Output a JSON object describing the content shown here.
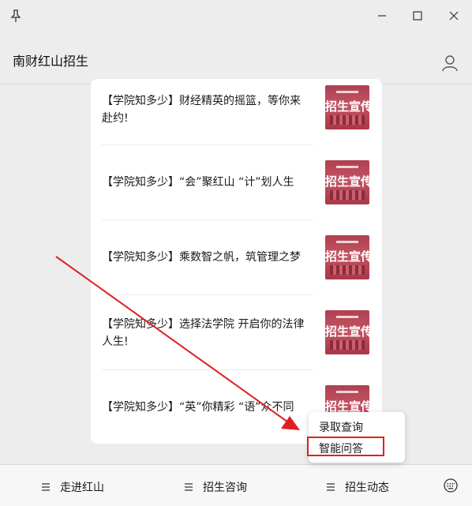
{
  "window": {
    "icons": [
      "pin-icon",
      "minimize-icon",
      "maximize-icon",
      "close-icon"
    ]
  },
  "header": {
    "title": "南财红山招生",
    "icon": "user-icon"
  },
  "articles": [
    {
      "title": "【学院知多少】财经精英的摇篮，等你来赴约!",
      "thumb_text": "招生宣传"
    },
    {
      "title": "【学院知多少】“会”聚红山 “计”划人生",
      "thumb_text": "招生宣传"
    },
    {
      "title": "【学院知多少】乘数智之帆，筑管理之梦",
      "thumb_text": "招生宣传"
    },
    {
      "title": "【学院知多少】选择法学院 开启你的法律人生!",
      "thumb_text": "招生宣传"
    },
    {
      "title": "【学院知多少】“英”你精彩 “语”众不同",
      "thumb_text": "招生宣传"
    }
  ],
  "menu": {
    "tabs": [
      {
        "label": "走进红山"
      },
      {
        "label": "招生咨询"
      },
      {
        "label": "招生动态"
      }
    ],
    "keyboard_icon": "keyboard-icon"
  },
  "popup": {
    "items": [
      {
        "label": "录取查询"
      },
      {
        "label": "智能问答"
      }
    ],
    "highlight_color": "#e02020"
  },
  "colors": {
    "thumb": "#b84a5a",
    "annotation": "#e02020"
  }
}
